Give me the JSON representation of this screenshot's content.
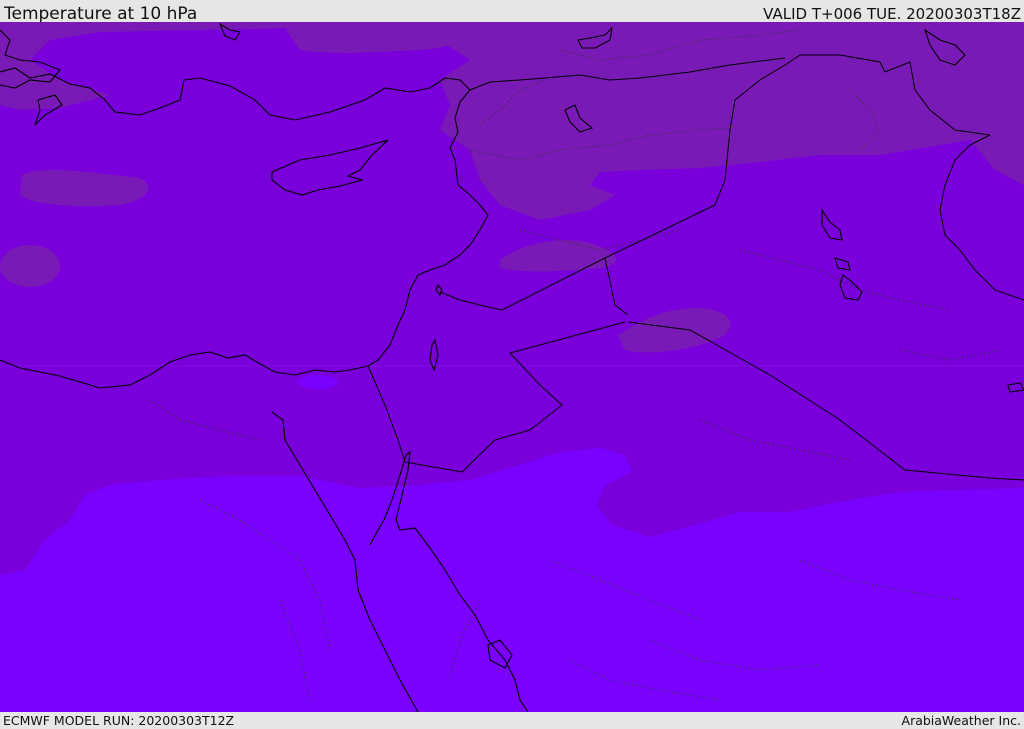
{
  "header": {
    "title": "Temperature at 10 hPa",
    "valid": "VALID T+006 TUE. 20200303T18Z"
  },
  "footer": {
    "model_run": "ECMWF MODEL RUN: 20200303T12Z",
    "credit": "ArabiaWeather Inc."
  },
  "map": {
    "region": "Eastern Mediterranean and Middle East",
    "field_colors": {
      "band_cold": "#7a1ab6",
      "band_main": "#7900db",
      "band_warm": "#7a00ff"
    },
    "line_colors": {
      "coastline": "#000000",
      "border": "#000000",
      "province": "#333333"
    }
  }
}
